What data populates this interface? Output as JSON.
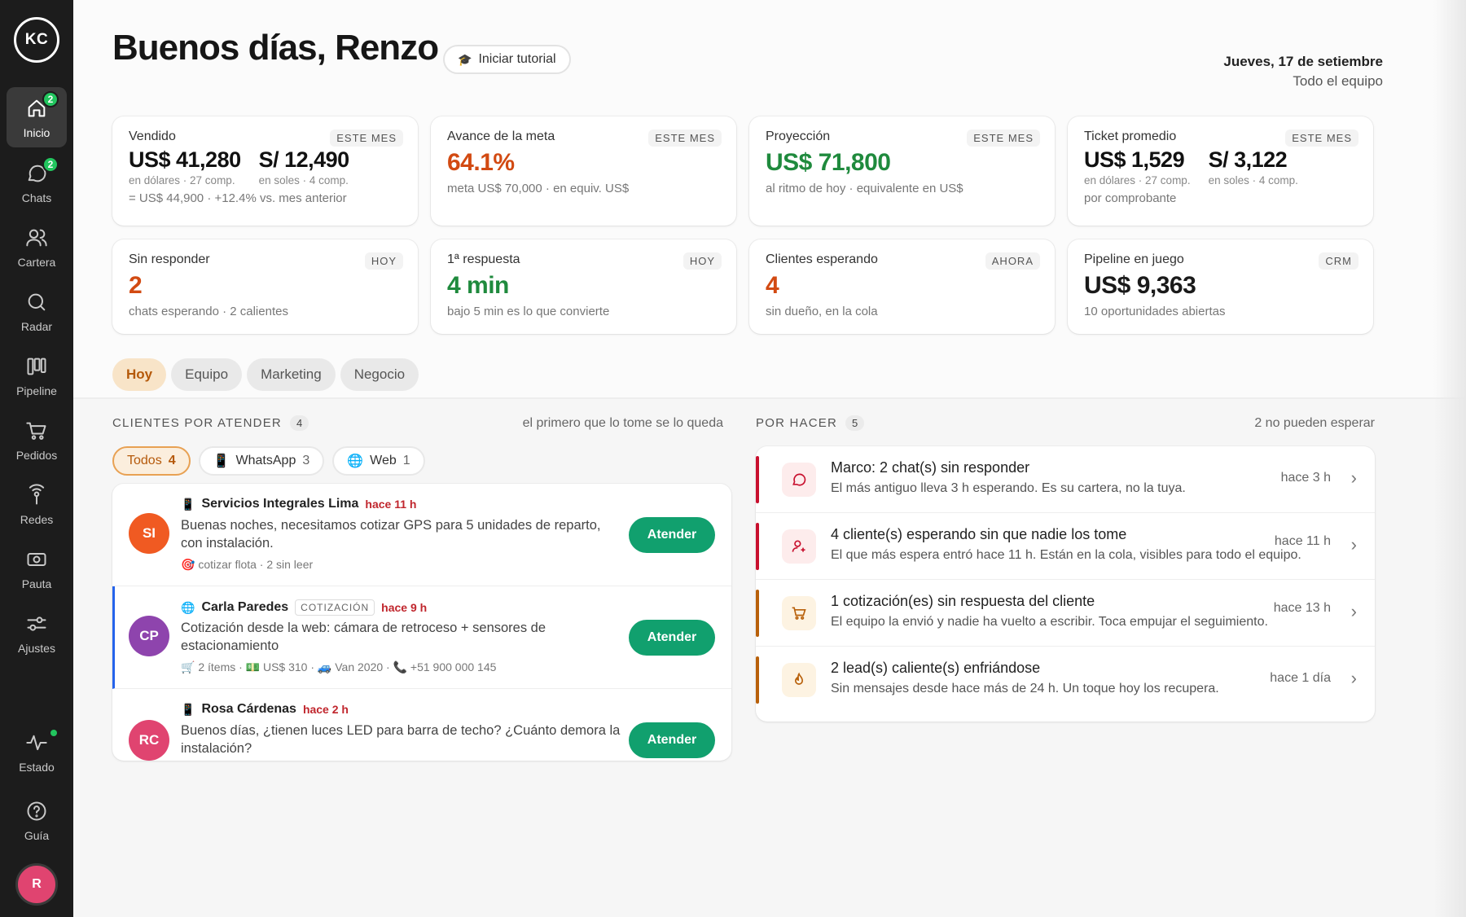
{
  "sidebar": {
    "logo": "KC",
    "items": [
      {
        "label": "Inicio",
        "icon": "home-icon",
        "badge": "2"
      },
      {
        "label": "Chats",
        "icon": "chat-icon",
        "badge": "2"
      },
      {
        "label": "Cartera",
        "icon": "users-icon"
      },
      {
        "label": "Radar",
        "icon": "search-icon"
      },
      {
        "label": "Pipeline",
        "icon": "pipeline-icon"
      },
      {
        "label": "Pedidos",
        "icon": "cart-icon"
      },
      {
        "label": "Redes",
        "icon": "signal-icon"
      },
      {
        "label": "Pauta",
        "icon": "ads-icon"
      },
      {
        "label": "Ajustes",
        "icon": "sliders-icon"
      }
    ],
    "status_label": "Estado",
    "guide_label": "Guía",
    "user_initial": "R"
  },
  "header": {
    "greeting": "Buenos días, Renzo",
    "tutorial_label": "Iniciar tutorial",
    "date": "Jueves, 17 de setiembre",
    "team": "Todo el equipo"
  },
  "cards": {
    "vendido": {
      "title": "Vendido",
      "tag": "ESTE MES",
      "usd": "US$ 41,280",
      "usd_sub": "en dólares · 27 comp.",
      "pen": "S/ 12,490",
      "pen_sub": "en soles · 4 comp.",
      "foot": "= US$ 44,900 · +12.4% vs. mes anterior"
    },
    "meta": {
      "title": "Avance de la meta",
      "tag": "ESTE MES",
      "value": "64.1%",
      "sub": "meta US$ 70,000 · en equiv. US$"
    },
    "proyeccion": {
      "title": "Proyección",
      "tag": "ESTE MES",
      "value": "US$ 71,800",
      "sub": "al ritmo de hoy · equivalente en US$"
    },
    "ticket": {
      "title": "Ticket promedio",
      "tag": "ESTE MES",
      "usd": "US$ 1,529",
      "usd_sub": "en dólares · 27 comp.",
      "pen": "S/ 3,122",
      "pen_sub": "en soles · 4 comp.",
      "foot": "por comprobante"
    },
    "sin_responder": {
      "title": "Sin responder",
      "tag": "HOY",
      "value": "2",
      "sub": "chats esperando · 2 calientes"
    },
    "respuesta": {
      "title": "1ª respuesta",
      "tag": "HOY",
      "value": "4 min",
      "sub": "bajo 5 min es lo que convierte"
    },
    "esperando": {
      "title": "Clientes esperando",
      "tag": "AHORA",
      "value": "4",
      "sub": "sin dueño, en la cola"
    },
    "pipeline": {
      "title": "Pipeline en juego",
      "tag": "CRM",
      "value": "US$ 9,363",
      "sub": "10 oportunidades abiertas"
    }
  },
  "tabs": [
    "Hoy",
    "Equipo",
    "Marketing",
    "Negocio"
  ],
  "clients_section": {
    "title": "CLIENTES POR ATENDER",
    "count": "4",
    "hint": "el primero que lo tome se lo queda",
    "filters": [
      {
        "label": "Todos",
        "count": "4"
      },
      {
        "label": "WhatsApp",
        "count": "3"
      },
      {
        "label": "Web",
        "count": "1"
      }
    ],
    "attend_label": "Atender",
    "rows": [
      {
        "initials": "SI",
        "name": "Servicios Integrales Lima",
        "ago": "hace 11 h",
        "message": "Buenas noches, necesitamos cotizar GPS para 5 unidades de reparto, con instalación.",
        "meta": "🎯 cotizar flota · 2 sin leer",
        "color": "#f05a22"
      },
      {
        "initials": "CP",
        "name": "Carla Paredes",
        "tag": "COTIZACIÓN",
        "ago": "hace 9 h",
        "message": "Cotización desde la web: cámara de retroceso + sensores de estacionamiento",
        "meta": "🛒 2 ítems · 💵 US$ 310 · 🚙 Van 2020 · 📞 +51 900 000 145",
        "color": "#8e44ad"
      },
      {
        "initials": "RC",
        "name": "Rosa Cárdenas",
        "ago": "hace 2 h",
        "message": "Buenos días, ¿tienen luces LED para barra de techo? ¿Cuánto demora la instalación?",
        "color": "#e04470"
      }
    ]
  },
  "todo_section": {
    "title": "POR HACER",
    "count": "5",
    "hint": "2 no pueden esperar",
    "rows": [
      {
        "title": "Marco: 2 chat(s) sin responder",
        "sub": "El más antiguo lleva 3 h esperando. Es su cartera, no la tuya.",
        "ago": "hace 3 h",
        "icon": "chat-icon",
        "color": "#c8102e"
      },
      {
        "title": "4 cliente(s) esperando sin que nadie los tome",
        "sub": "El que más espera entró hace 11 h. Están en la cola, visibles para todo el equipo.",
        "ago": "hace 11 h",
        "icon": "user-plus-icon",
        "color": "#c8102e"
      },
      {
        "title": "1 cotización(es) sin respuesta del cliente",
        "sub": "El equipo la envió y nadie ha vuelto a escribir. Toca empujar el seguimiento.",
        "ago": "hace 13 h",
        "icon": "cart-icon",
        "color": "#b8600a"
      },
      {
        "title": "2 lead(s) caliente(s) enfriándose",
        "sub": "Sin mensajes desde hace más de 24 h. Un toque hoy los recupera.",
        "ago": "hace 1 día",
        "icon": "flame-icon",
        "color": "#b8600a"
      }
    ]
  }
}
